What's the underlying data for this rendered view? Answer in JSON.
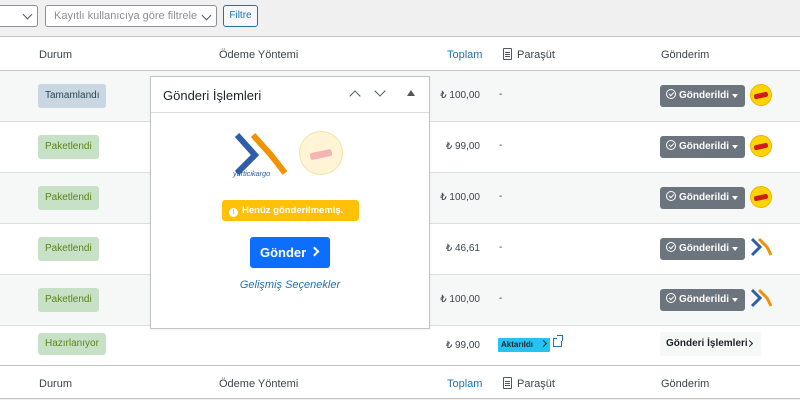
{
  "toolbar": {
    "filter_placeholder": "Kayıtlı kullanıcıya göre filtrele",
    "filter_button": "Filtre"
  },
  "columns": {
    "durum": "Durum",
    "odeme": "Ödeme Yöntemi",
    "toplam": "Toplam",
    "parasut": "Paraşüt",
    "gonderim": "Gönderim"
  },
  "rows": [
    {
      "status": "Tamamlandı",
      "total": "₺ 100,00",
      "parasut": "-",
      "shipping": "Gönderildi",
      "carrier": "kolay-gelsin"
    },
    {
      "status": "Paketlendi",
      "total": "₺ 99,00",
      "parasut": "-",
      "shipping": "Gönderildi",
      "carrier": "kolay-gelsin"
    },
    {
      "status": "Paketlendi",
      "total": "₺ 100,00",
      "parasut": "-",
      "shipping": "Gönderildi",
      "carrier": "kolay-gelsin"
    },
    {
      "status": "Paketlendi",
      "total": "₺ 46,61",
      "parasut": "-",
      "shipping": "Gönderildi",
      "carrier": "yurtici-kargo"
    },
    {
      "status": "Paketlendi",
      "total": "₺ 100,00",
      "parasut": "-",
      "shipping": "Gönderildi",
      "carrier": "yurtici-kargo"
    },
    {
      "status": "Hazırlanıyor",
      "total": "₺ 99,00",
      "parasut_badge": "Aktarıldı",
      "shipping_ops": "Gönderi İşlemleri"
    }
  ],
  "popover": {
    "title": "Gönderi İşlemleri",
    "yk_logo_text": "yurticikargo",
    "warning": "Henüz gönderilmemiş.",
    "send_button": "Gönder",
    "advanced_link": "Gelişmiş Seçenekler"
  },
  "colors": {
    "accent": "#2271b1",
    "send_button": "#0d6efd",
    "warning": "#ffc107",
    "sent_button": "#6c757d",
    "parasut_badge": "#25c3f0"
  }
}
